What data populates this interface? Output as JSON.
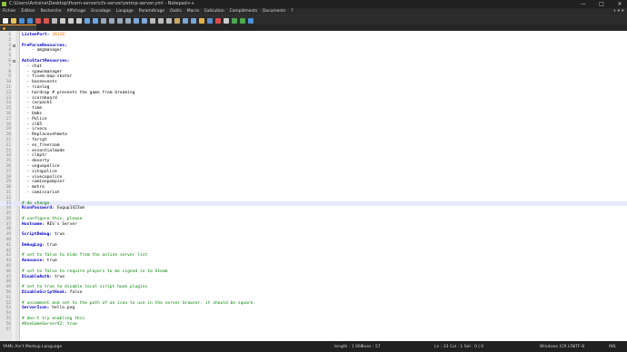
{
  "window": {
    "title": "C:\\Users\\Antoine\\Desktop\\fivem-server\\cfx-server\\zetmp-server.yml - Notepad++",
    "minimize": "—",
    "maximize": "□",
    "close": "✕"
  },
  "menu": [
    "Fichier",
    "Édition",
    "Recherche",
    "Affichage",
    "Encodage",
    "Langage",
    "Paramétrage",
    "Outils",
    "Macro",
    "Exécution",
    "Compléments",
    "Documents",
    "?"
  ],
  "menu_right": "+ ▾ ✕",
  "toolbar_icons": [
    "new-file-icon",
    "open-file-icon",
    "save-icon",
    "save-all-icon",
    "close-icon",
    "close-all-icon",
    "print-icon",
    "cut-icon",
    "copy-icon",
    "paste-icon",
    "undo-icon",
    "redo-icon",
    "find-icon",
    "replace-icon",
    "zoom-in-icon",
    "zoom-out-icon",
    "sync-v-icon",
    "sync-h-icon",
    "wrap-icon",
    "all-chars-icon",
    "indent-guide-icon",
    "udl-icon",
    "doc-map-icon",
    "func-list-icon",
    "folder-workspace-icon",
    "monitor-icon",
    "record-macro-icon",
    "stop-macro-icon",
    "play-macro-icon",
    "run-macro-icon",
    "save-macro-icon"
  ],
  "tab": {
    "label": ""
  },
  "lines": [
    {
      "n": "1",
      "segs": [
        [
          "k",
          "ListenPort: "
        ],
        [
          "n",
          "30120"
        ]
      ]
    },
    {
      "n": "2",
      "segs": []
    },
    {
      "n": "3",
      "fold": true,
      "segs": [
        [
          "k",
          "PreParseResources:"
        ]
      ]
    },
    {
      "n": "4",
      "segs": [
        [
          "t",
          "    - amgmanager"
        ]
      ]
    },
    {
      "n": "5",
      "segs": []
    },
    {
      "n": "6",
      "fold": true,
      "segs": [
        [
          "k",
          "AutoStartResources:"
        ]
      ]
    },
    {
      "n": "7",
      "segs": [
        [
          "t",
          "  - chat"
        ]
      ]
    },
    {
      "n": "8",
      "segs": [
        [
          "t",
          "  - spawnmanager"
        ]
      ]
    },
    {
      "n": "9",
      "segs": [
        [
          "t",
          "  - fivem-map-skater"
        ]
      ]
    },
    {
      "n": "10",
      "segs": [
        [
          "t",
          "  - baseevents"
        ]
      ]
    },
    {
      "n": "11",
      "segs": [
        [
          "t",
          "  - rconlog"
        ]
      ]
    },
    {
      "n": "12",
      "segs": [
        [
          "t",
          "  - hardcap # prevents the game from breaking"
        ]
      ]
    },
    {
      "n": "13",
      "segs": [
        [
          "t",
          "  - scoreboard"
        ]
      ]
    },
    {
      "n": "14",
      "segs": [
        [
          "t",
          "  - carpack1"
        ]
      ]
    },
    {
      "n": "15",
      "segs": [
        [
          "t",
          "  - time"
        ]
      ]
    },
    {
      "n": "16",
      "segs": [
        [
          "t",
          "  - bmbs"
        ]
      ]
    },
    {
      "n": "17",
      "segs": [
        [
          "t",
          "  - Police"
        ]
      ]
    },
    {
      "n": "18",
      "segs": [
        [
          "t",
          "  - sl65"
        ]
      ]
    },
    {
      "n": "19",
      "segs": [
        [
          "t",
          "  - irveco"
        ]
      ]
    },
    {
      "n": "20",
      "segs": [
        [
          "t",
          "  - Replacevehmeta"
        ]
      ]
    },
    {
      "n": "21",
      "segs": [
        [
          "t",
          "  - forcgt"
        ]
      ]
    },
    {
      "n": "22",
      "segs": [
        [
          "t",
          "  - es_freeroam"
        ]
      ]
    },
    {
      "n": "23",
      "segs": [
        [
          "t",
          "  - essentialmode"
        ]
      ]
    },
    {
      "n": "24",
      "segs": [
        [
          "t",
          "  - clkptr"
        ]
      ]
    },
    {
      "n": "25",
      "segs": [
        [
          "t",
          "  - deserty"
        ]
      ]
    },
    {
      "n": "26",
      "segs": [
        [
          "t",
          "  - voguepolice"
        ]
      ]
    },
    {
      "n": "27",
      "segs": [
        [
          "t",
          "  - vitopolice"
        ]
      ]
    },
    {
      "n": "28",
      "segs": [
        [
          "t",
          "  - vivecopolice"
        ]
      ]
    },
    {
      "n": "29",
      "segs": [
        [
          "t",
          "  - camionpompier"
        ]
      ]
    },
    {
      "n": "30",
      "segs": [
        [
          "t",
          "  - metro"
        ]
      ]
    },
    {
      "n": "31",
      "segs": [
        [
          "t",
          "  - comissariat"
        ]
      ]
    },
    {
      "n": "32",
      "segs": []
    },
    {
      "n": "33",
      "cur": true,
      "segs": [
        [
          "c",
          "# do change"
        ]
      ]
    },
    {
      "n": "34",
      "segs": [
        [
          "k",
          "RconPassword: "
        ],
        [
          "t",
          "Gugup1423xm"
        ]
      ]
    },
    {
      "n": "35",
      "segs": []
    },
    {
      "n": "36",
      "segs": [
        [
          "c",
          "# configure this, please"
        ]
      ]
    },
    {
      "n": "37",
      "segs": [
        [
          "k",
          "Hostname: "
        ],
        [
          "t",
          "RES's Server"
        ]
      ]
    },
    {
      "n": "38",
      "segs": []
    },
    {
      "n": "39",
      "segs": [
        [
          "k",
          "ScriptDebug: "
        ],
        [
          "t",
          "true"
        ]
      ]
    },
    {
      "n": "40",
      "segs": []
    },
    {
      "n": "41",
      "segs": [
        [
          "k",
          "DebugLog: "
        ],
        [
          "t",
          "true"
        ]
      ]
    },
    {
      "n": "42",
      "segs": []
    },
    {
      "n": "43",
      "segs": [
        [
          "c",
          "# set to false to hide from the online server list"
        ]
      ]
    },
    {
      "n": "44",
      "segs": [
        [
          "k",
          "Announce: "
        ],
        [
          "t",
          "true"
        ]
      ]
    },
    {
      "n": "45",
      "segs": []
    },
    {
      "n": "46",
      "segs": [
        [
          "c",
          "# set to false to require players to be signed in to Steam"
        ]
      ]
    },
    {
      "n": "47",
      "segs": [
        [
          "k",
          "DisableAuth: "
        ],
        [
          "t",
          "true"
        ]
      ]
    },
    {
      "n": "48",
      "segs": []
    },
    {
      "n": "49",
      "segs": [
        [
          "c",
          "# set to true to disable local script hook plugins"
        ]
      ]
    },
    {
      "n": "50",
      "segs": [
        [
          "k",
          "DisableScriptHook: "
        ],
        [
          "t",
          "false"
        ]
      ]
    },
    {
      "n": "51",
      "segs": []
    },
    {
      "n": "52",
      "segs": [
        [
          "c",
          "# uncomment and set to the path of an icon to use in the server browser. it should be square."
        ]
      ]
    },
    {
      "n": "53",
      "segs": [
        [
          "k",
          "ServerIcon: "
        ],
        [
          "t",
          "hello.png"
        ]
      ]
    },
    {
      "n": "54",
      "segs": []
    },
    {
      "n": "55",
      "segs": [
        [
          "c",
          "# don't try enabling this"
        ]
      ]
    },
    {
      "n": "56",
      "segs": [
        [
          "c",
          "#UseGameServerV2: true"
        ]
      ]
    },
    {
      "n": "57",
      "segs": []
    }
  ],
  "status": {
    "language": "YAML Ain't Markup Language",
    "length": "length : 1 060",
    "lines": "lines : 57",
    "position": "Ln : 33    Col : 1    Sel : 0 | 0",
    "eol": "Windows (CR LF)",
    "encoding": "UTF-8",
    "mode": "INS"
  },
  "colors": {
    "keyword": "#0000cc",
    "number": "#ff6a00",
    "comment": "#008000",
    "chrome": "#202020"
  }
}
